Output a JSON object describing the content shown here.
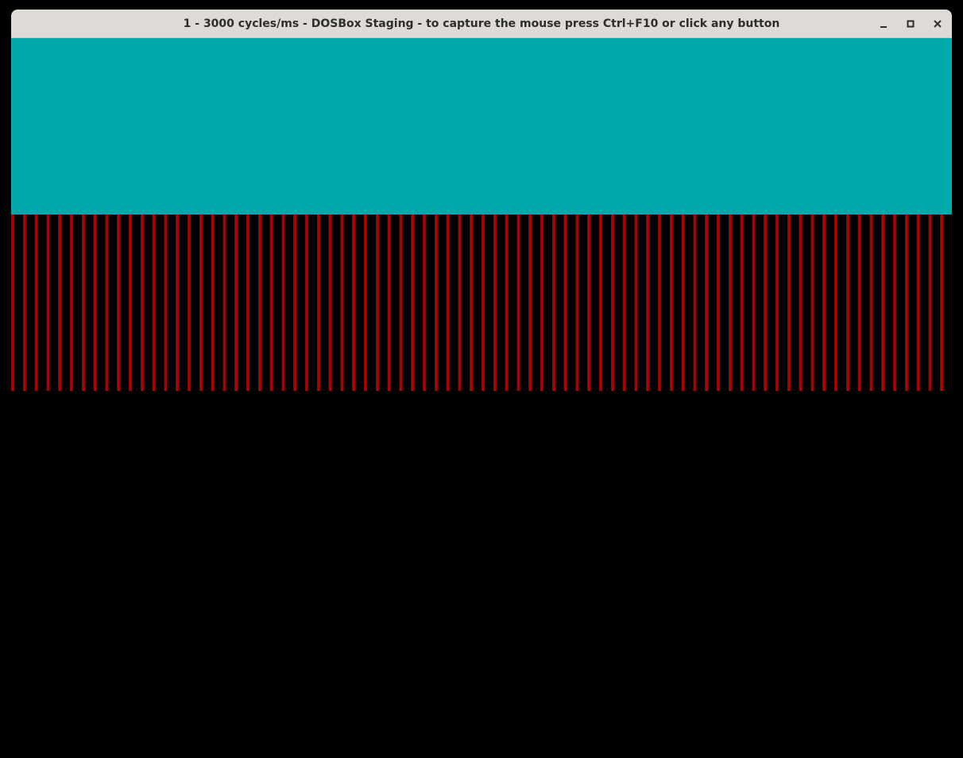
{
  "window": {
    "title": "1 - 3000 cycles/ms - DOSBox Staging - to capture the mouse press Ctrl+F10 or click any button",
    "controls": {
      "minimize": "minimize-icon",
      "maximize": "maximize-icon",
      "close": "close-icon"
    }
  },
  "screen": {
    "colors": {
      "top_band": "#00aaaa",
      "stripes": "#aa0000",
      "background": "#000000"
    },
    "stripe_count": 80
  }
}
